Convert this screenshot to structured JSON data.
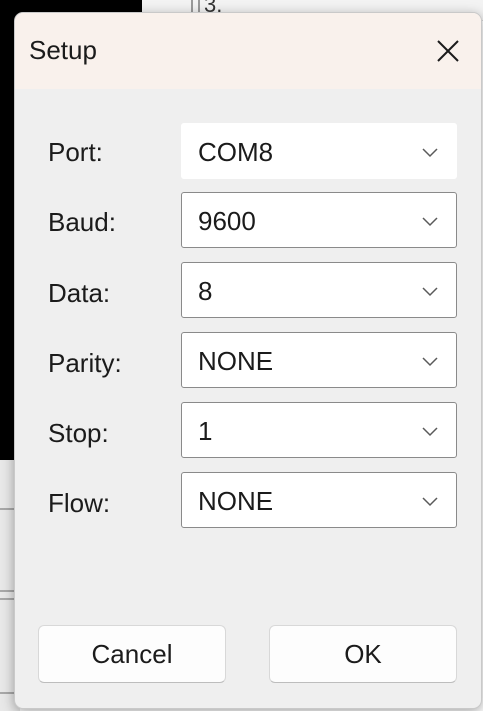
{
  "dialog": {
    "title": "Setup",
    "close_icon": "close-icon",
    "fields": [
      {
        "label": "Port:",
        "value": "COM8"
      },
      {
        "label": "Baud:",
        "value": "9600"
      },
      {
        "label": "Data:",
        "value": "8"
      },
      {
        "label": "Parity:",
        "value": "NONE"
      },
      {
        "label": "Stop:",
        "value": "1"
      },
      {
        "label": "Flow:",
        "value": "NONE"
      }
    ],
    "cancel_label": "Cancel",
    "ok_label": "OK"
  },
  "background": {
    "partial_text_top": "3."
  },
  "colors": {
    "titlebar": "#f9f1ec",
    "dialog_bg": "#efefef",
    "input_border": "#8a8a8a"
  }
}
